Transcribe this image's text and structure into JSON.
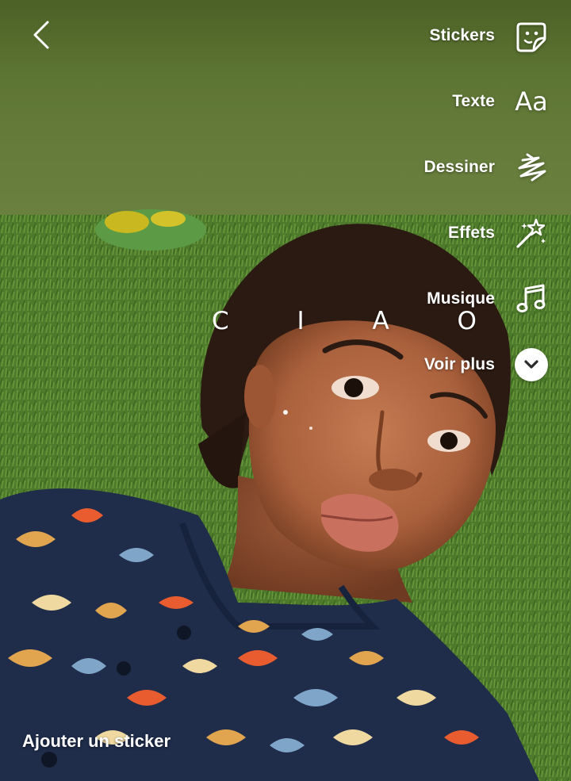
{
  "header": {
    "back_icon": "chevron-left-icon"
  },
  "tools": [
    {
      "label": "Stickers",
      "icon": "sticker-icon"
    },
    {
      "label": "Texte",
      "icon": "text-aa-icon",
      "glyph": "Aa"
    },
    {
      "label": "Dessiner",
      "icon": "scribble-icon"
    },
    {
      "label": "Effets",
      "icon": "magic-wand-icon"
    },
    {
      "label": "Musique",
      "icon": "music-note-icon"
    },
    {
      "label": "Voir plus",
      "icon": "chevron-down-circle-icon"
    }
  ],
  "canvas": {
    "overlay_text": "C I A O"
  },
  "footer": {
    "add_sticker_label": "Ajouter un sticker"
  },
  "colors": {
    "top_band": "#5d7533",
    "grass": "#4f7a2c",
    "shirt": "#22304d",
    "skin": "#b9704a",
    "text": "#ffffff"
  }
}
